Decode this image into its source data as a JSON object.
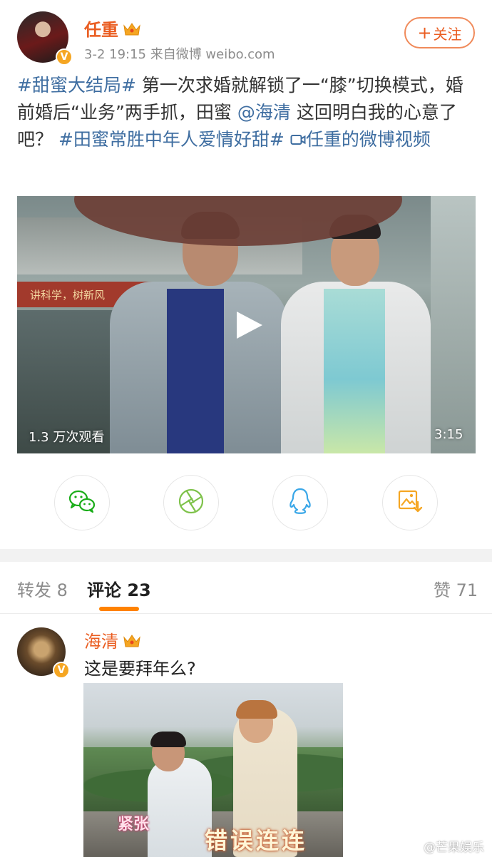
{
  "post": {
    "author": {
      "name": "任重",
      "verified_badge": "V",
      "avatar": "author-avatar"
    },
    "meta": "3-2 19:15  来自微博 weibo.com",
    "follow_label": "关注",
    "text": {
      "tag1": "#甜蜜大结局#",
      "body1": " 第一次求婚就解锁了一“膝”切换模式，婚前婚后“业务”两手抓，田蜜 ",
      "mention": "@海清",
      "body2": " 这回明白我的心意了吧？ ",
      "tag2": "#田蜜常胜中年人爱情好甜#",
      "video_link_icon": "video-link-icon",
      "video_link": "任重的微博视频"
    },
    "video": {
      "banner_text": "讲科学，树新风",
      "views": "1.3 万次观看",
      "duration": "3:15"
    },
    "share_icons": [
      "wechat-icon",
      "moments-icon",
      "qq-icon",
      "save-image-icon"
    ]
  },
  "tabs": {
    "repost": "转发 8",
    "comments": "评论 23",
    "likes": "赞 71"
  },
  "comment": {
    "author": "海清",
    "verified_badge": "V",
    "text": "这是要拜年么?",
    "image": {
      "caption_small": "紧张",
      "caption_big": "错误连连"
    }
  },
  "watermark": "@芒果娱乐",
  "colors": {
    "orange": "#ea5d21",
    "link_blue": "#3f6ea1",
    "tab_indicator": "#ff8200",
    "wechat_green": "#1aad19",
    "qq_blue": "#3aa7e8",
    "save_orange": "#f5a623"
  }
}
